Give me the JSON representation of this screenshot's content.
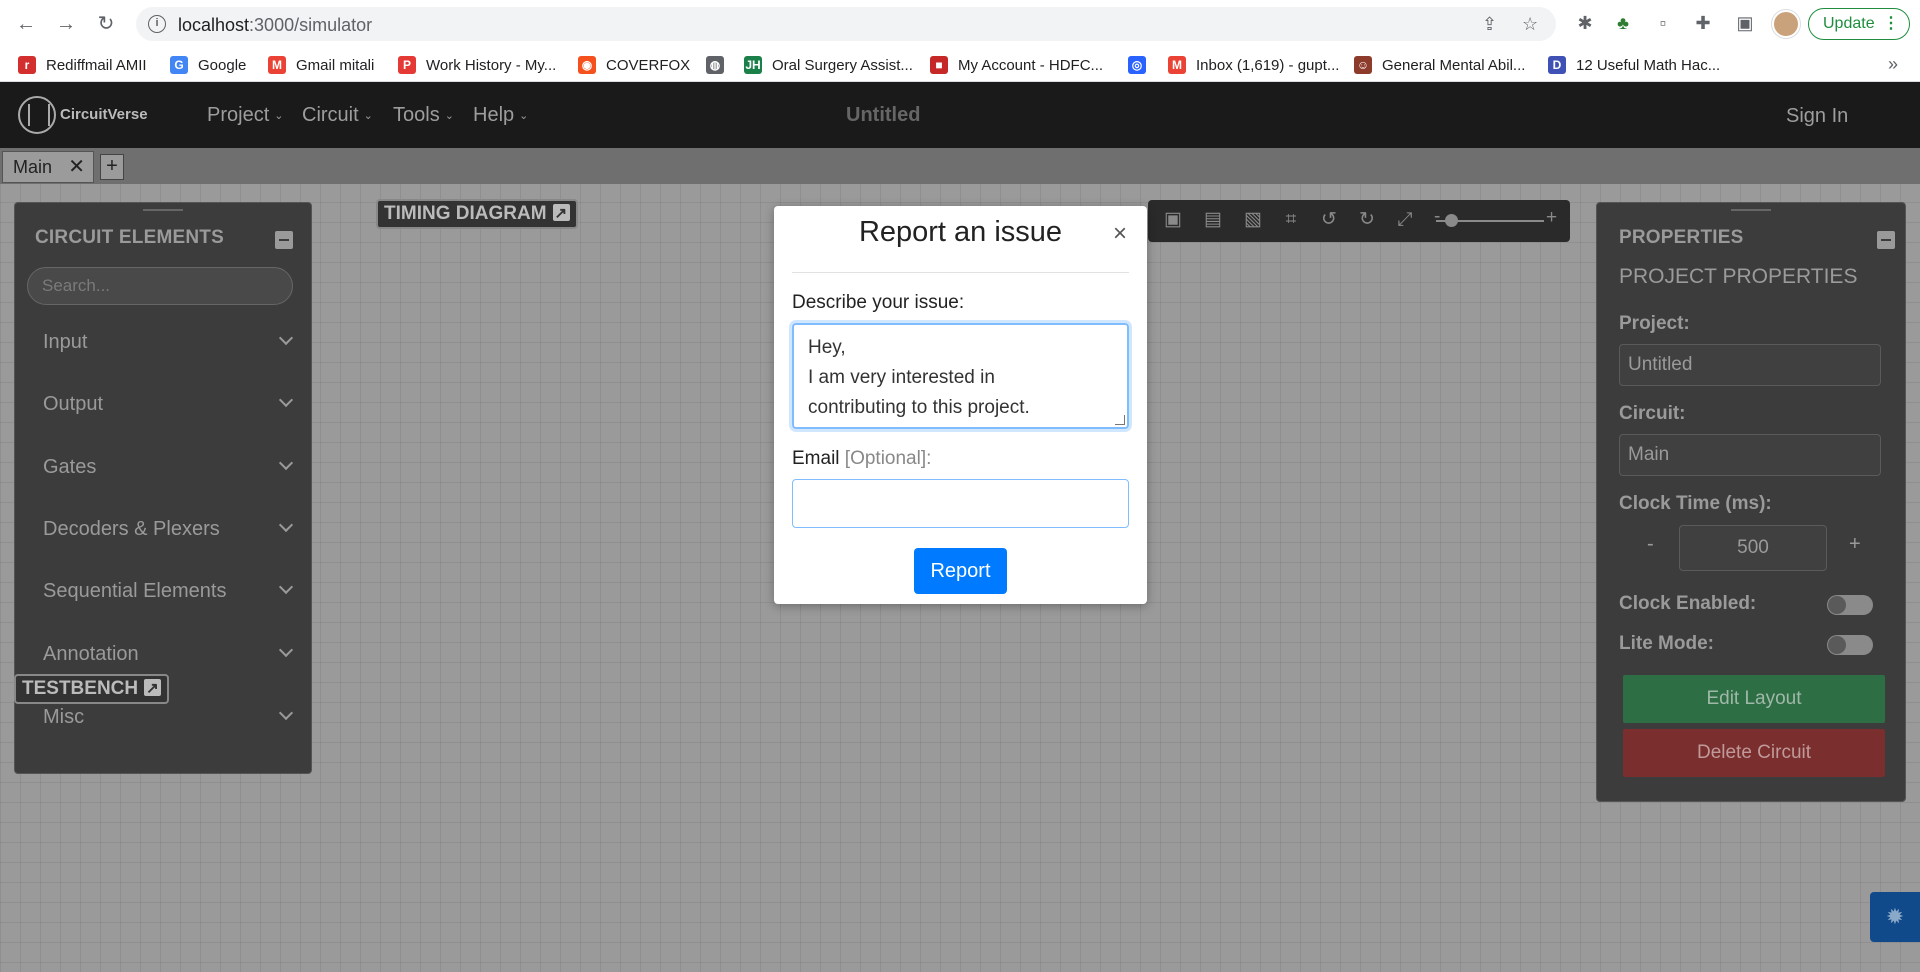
{
  "browser": {
    "url_host": "localhost",
    "url_path": ":3000/simulator",
    "update_label": "Update",
    "bookmarks": [
      {
        "label": "Rediffmail AMII",
        "color": "#d32f2f"
      },
      {
        "label": "Google",
        "color": "#4285f4"
      },
      {
        "label": "Gmail mitali",
        "color": "#ea4335"
      },
      {
        "label": "Work History - My...",
        "color": "#e53935"
      },
      {
        "label": "COVERFOX",
        "color": "#f4511e"
      },
      {
        "label": "",
        "color": "#5f6368"
      },
      {
        "label": "Oral Surgery Assist...",
        "color": "#1b7f4a"
      },
      {
        "label": "My Account - HDFC...",
        "color": "#c62828"
      },
      {
        "label": "",
        "color": "#2962ff"
      },
      {
        "label": "Inbox (1,619) - gupt...",
        "color": "#ea4335"
      },
      {
        "label": "General Mental Abil...",
        "color": "#8d3b2b"
      },
      {
        "label": "12 Useful Math Hac...",
        "color": "#3f51b5"
      }
    ]
  },
  "navbar": {
    "logo_text": "CircuitVerse",
    "menus": [
      "Project",
      "Circuit",
      "Tools",
      "Help"
    ],
    "title": "Untitled",
    "sign_in": "Sign In"
  },
  "tabs": {
    "active": "Main",
    "close_glyph": "✕",
    "add_glyph": "+"
  },
  "elements_panel": {
    "header": "CIRCUIT ELEMENTS",
    "search_placeholder": "Search...",
    "categories": [
      "Input",
      "Output",
      "Gates",
      "Decoders & Plexers",
      "Sequential Elements",
      "Annotation",
      "Misc"
    ]
  },
  "badges": {
    "timing": "TIMING DIAGRAM",
    "testbench": "TESTBENCH"
  },
  "toolbar": {
    "zoom_minus": "-",
    "zoom_plus": "+",
    "zoom_level": 0.14
  },
  "properties": {
    "header": "PROPERTIES",
    "subheader": "PROJECT PROPERTIES",
    "project_label": "Project:",
    "project_value": "Untitled",
    "circuit_label": "Circuit:",
    "circuit_value": "Main",
    "clock_label": "Clock Time (ms):",
    "clock_minus": "-",
    "clock_value": "500",
    "clock_plus": "+",
    "clock_enabled_label": "Clock Enabled:",
    "lite_mode_label": "Lite Mode:",
    "edit_layout": "Edit Layout",
    "delete_circuit": "Delete Circuit"
  },
  "modal": {
    "title": "Report an issue",
    "close_glyph": "×",
    "describe_label": "Describe your issue:",
    "issue_text": "Hey,\nI am very interested in\ncontributing to this project.",
    "email_label": "Email",
    "email_optional": "[Optional]:",
    "email_value": "",
    "report_button": "Report"
  }
}
